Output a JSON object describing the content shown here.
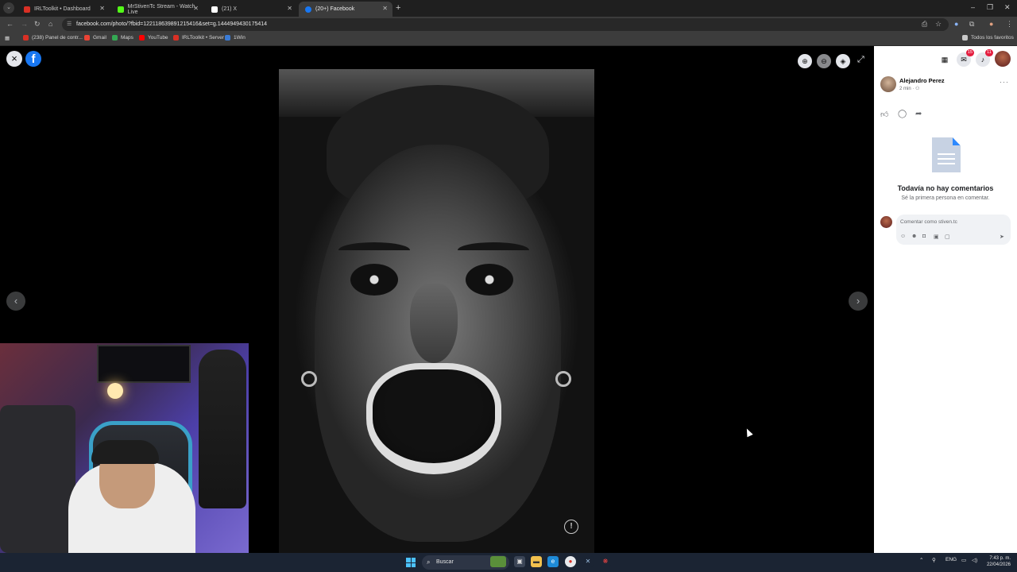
{
  "browser": {
    "tabs": [
      {
        "label": "IRLToolkit • Dashboard",
        "color": "#d93025"
      },
      {
        "label": "MrStivenTc Stream - Watch Live",
        "color": "#53fc18"
      },
      {
        "label": "(21) X",
        "color": "#ffffff"
      },
      {
        "label": "(20+) Facebook",
        "color": "#1877f2"
      }
    ],
    "url": "facebook.com/photo/?fbid=122118639891215416&set=g.1444949430175414",
    "bookmarks": [
      {
        "label": "(238) Panel de contr...",
        "color": "#d93025"
      },
      {
        "label": "Gmail",
        "color": "#ea4335"
      },
      {
        "label": "Maps",
        "color": "#34a853"
      },
      {
        "label": "YouTube",
        "color": "#ff0000"
      },
      {
        "label": "IRLToolkit • Server",
        "color": "#d93025"
      },
      {
        "label": "1Win",
        "color": "#3a7bd5"
      }
    ],
    "all_bookmarks": "Todos los favoritos"
  },
  "viewer": {
    "close_icon": "×",
    "fb_logo": "f"
  },
  "panel": {
    "messenger_badge": "15",
    "notif_badge": "11",
    "author": "Alejandro Perez",
    "time": "2 min",
    "empty_title": "Todavía no hay comentarios",
    "empty_subtitle": "Sé la primera persona en comentar.",
    "comment_placeholder": "Comentar como stiven.tc"
  },
  "taskbar": {
    "search": "Buscar",
    "lang": "ENG",
    "time": "7:43 p. m.",
    "date": "22/04/2026"
  }
}
